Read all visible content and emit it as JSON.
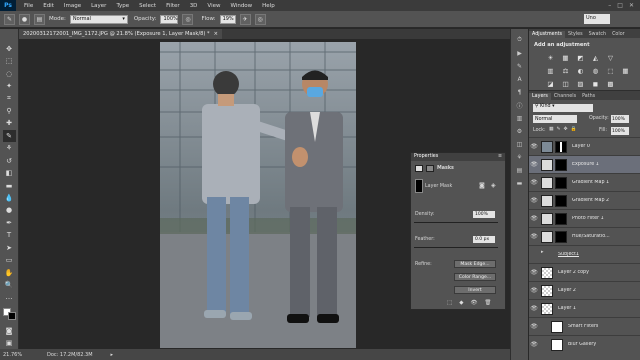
{
  "app": {
    "logo": "Ps"
  },
  "menu": [
    "File",
    "Edit",
    "Image",
    "Layer",
    "Type",
    "Select",
    "Filter",
    "3D",
    "View",
    "Window",
    "Help"
  ],
  "window_controls": [
    "–",
    "□",
    "✕"
  ],
  "options": {
    "mode_label": "Mode:",
    "mode_value": "Normal",
    "opacity_label": "Opacity:",
    "opacity_value": "100%",
    "flow_label": "Flow:",
    "flow_value": "19%",
    "workspace": "Uno"
  },
  "document_tab": {
    "title": "20200312172001_IMG_1172.JPG @ 21.8% (Exposure 1, Layer Mask/8) *",
    "close": "×"
  },
  "status": {
    "zoom": "21.76%",
    "doc": "Doc: 17.2M/82.3M"
  },
  "adjustments": {
    "tabs": [
      "Adjustments",
      "Styles",
      "Swatch",
      "Color"
    ],
    "title": "Add an adjustment",
    "icons_row1": [
      "☀",
      "▦",
      "◩",
      "◭",
      "▽",
      ""
    ],
    "icons_row2": [
      "▥",
      "⚖",
      "◐",
      "◍",
      "⬚",
      "▦"
    ],
    "icons_row3": [
      "◪",
      "◫",
      "▨",
      "◼",
      "▩",
      ""
    ]
  },
  "layers": {
    "tabs": [
      "Layers",
      "Channels",
      "Paths"
    ],
    "blend": "Normal",
    "opacity_label": "Opacity:",
    "opacity_value": "100%",
    "lock_label": "Lock:",
    "fill_label": "Fill:",
    "fill_value": "100%",
    "items": [
      {
        "name": "Layer 0",
        "eye": "👁",
        "kind": "photo"
      },
      {
        "name": "Exposure 1",
        "eye": "👁",
        "kind": "adj",
        "selected": true
      },
      {
        "name": "Gradient Map 1",
        "eye": "👁",
        "kind": "adj"
      },
      {
        "name": "Gradient Map 2",
        "eye": "👁",
        "kind": "adj"
      },
      {
        "name": "Photo Filter 1",
        "eye": "👁",
        "kind": "adj"
      },
      {
        "name": "Hue/Saturatio...",
        "eye": "👁",
        "kind": "adj"
      },
      {
        "name": "Subject1",
        "eye": "",
        "kind": "group"
      },
      {
        "name": "Layer 2 copy",
        "eye": "👁",
        "kind": "trans"
      },
      {
        "name": "Layer 2",
        "eye": "👁",
        "kind": "trans"
      },
      {
        "name": "Layer 1",
        "eye": "👁",
        "kind": "trans"
      },
      {
        "name": "Smart Filters",
        "eye": "👁",
        "kind": "smart"
      },
      {
        "name": "Blur Gallery",
        "eye": "👁",
        "kind": "filter"
      }
    ]
  },
  "properties": {
    "tab": "Properties",
    "masks_label": "Masks",
    "layer_mask_label": "Layer Mask",
    "density_label": "Density:",
    "density_value": "100%",
    "feather_label": "Feather:",
    "feather_value": "0.0 px",
    "refine_label": "Refine:",
    "buttons": [
      "Mask Edge...",
      "Color Range...",
      "Invert"
    ]
  },
  "colors": {
    "accent_selected": "#6b6f7a",
    "panel": "#535353",
    "app_bg": "#282828"
  }
}
